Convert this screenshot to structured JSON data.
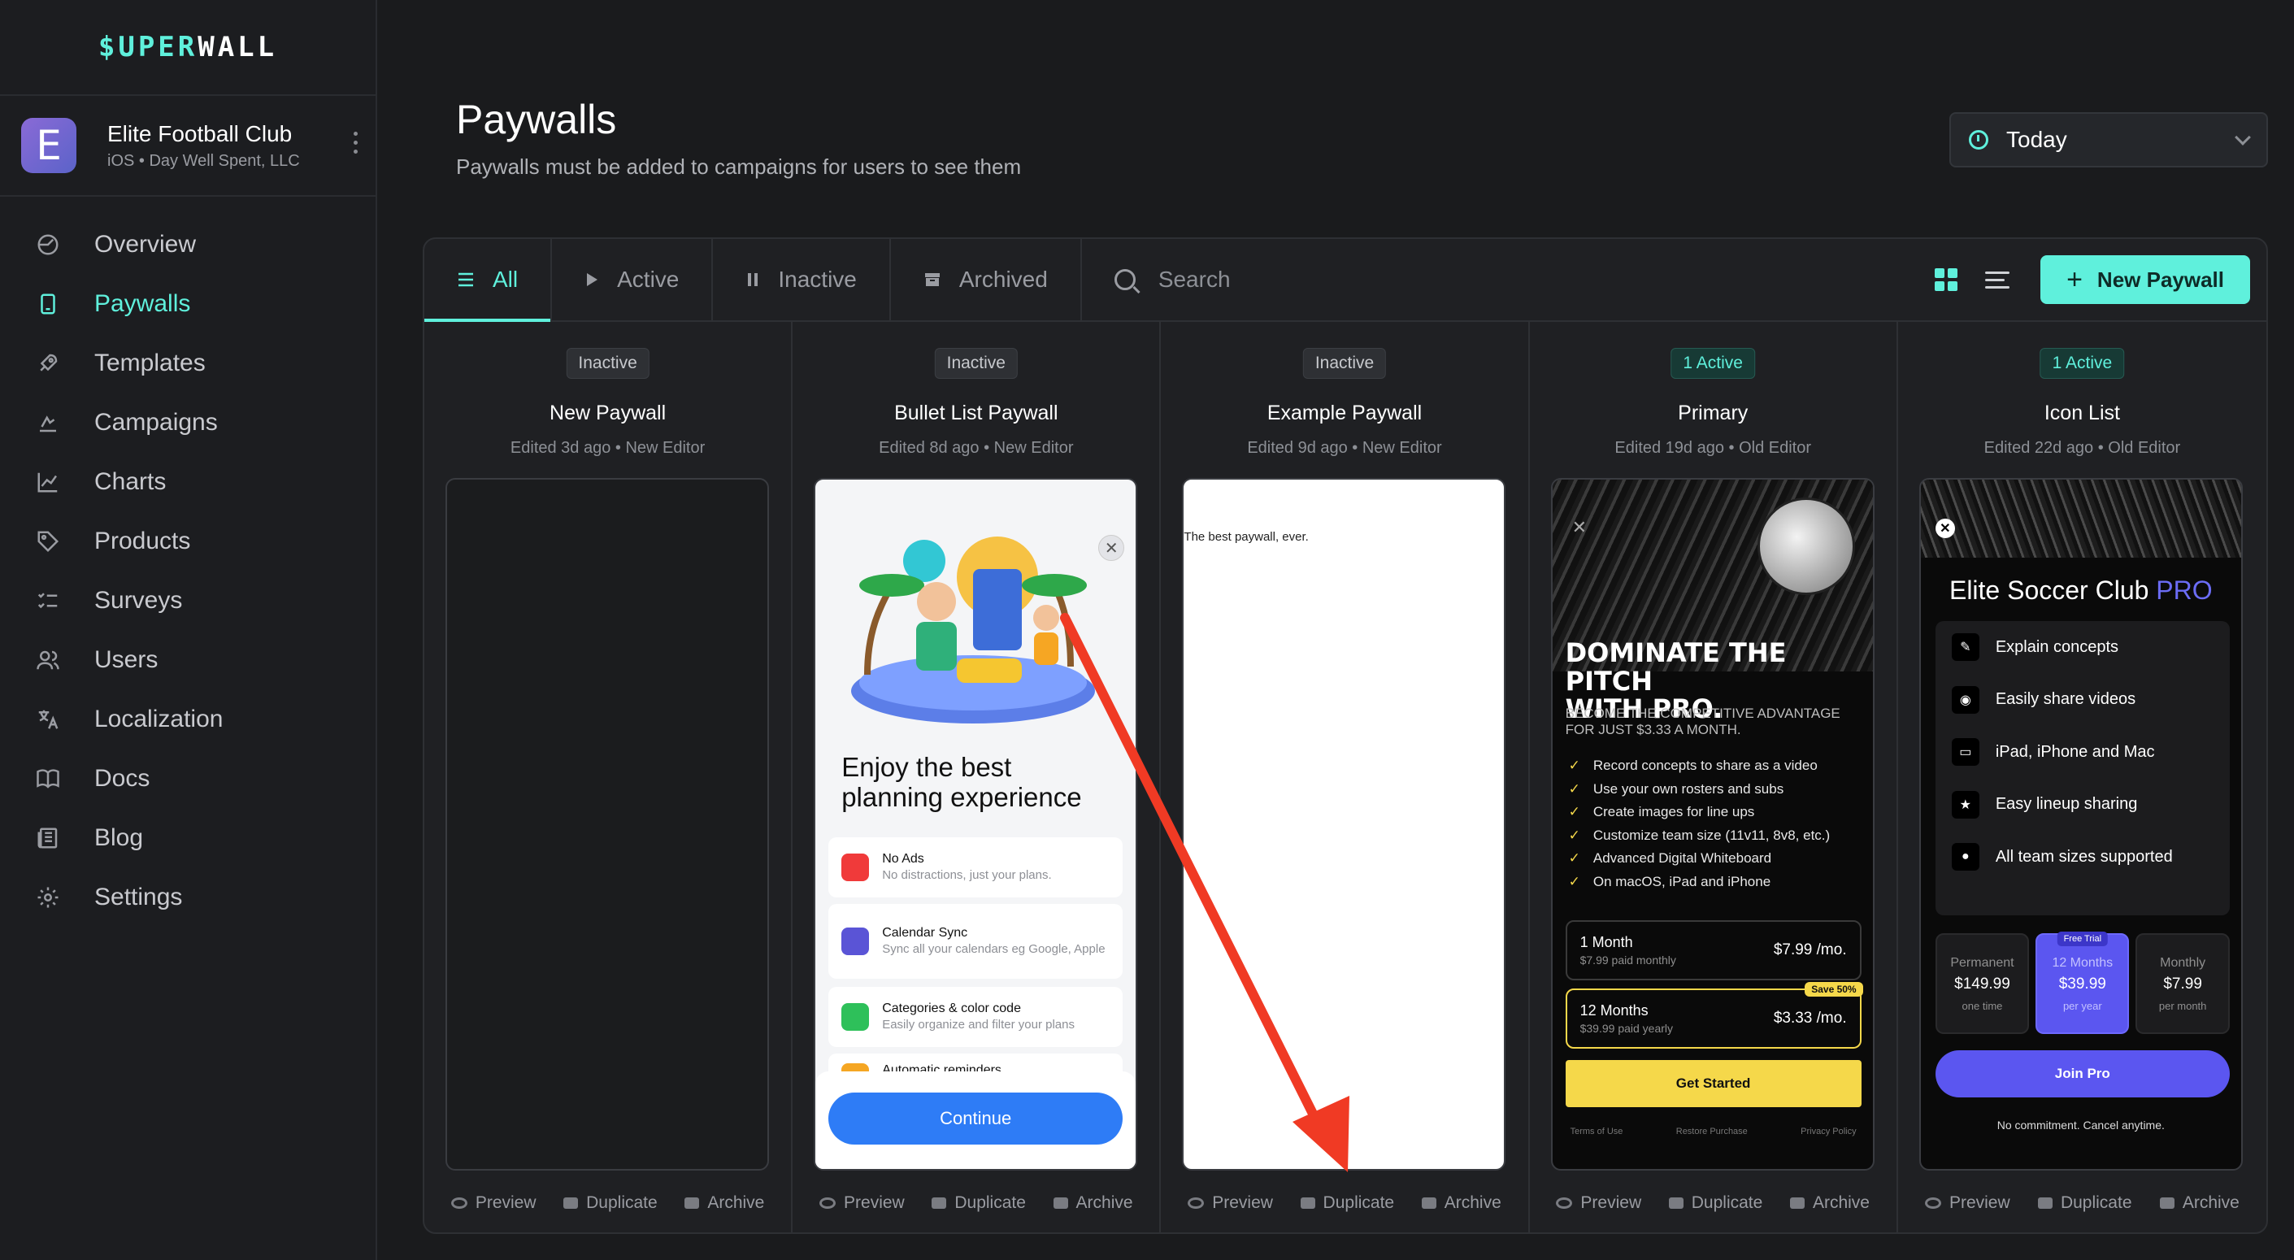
{
  "brand": {
    "logo_part1": "$UPER",
    "logo_part2": "WALL"
  },
  "org": {
    "avatar_letter": "E",
    "name": "Elite Football Club",
    "subtitle": "iOS • Day Well Spent, LLC"
  },
  "nav": [
    {
      "label": "Overview",
      "icon": "clock-icon"
    },
    {
      "label": "Paywalls",
      "icon": "phone-icon",
      "active": true
    },
    {
      "label": "Templates",
      "icon": "rocket-icon"
    },
    {
      "label": "Campaigns",
      "icon": "campaign-icon"
    },
    {
      "label": "Charts",
      "icon": "chart-icon"
    },
    {
      "label": "Products",
      "icon": "tag-icon"
    },
    {
      "label": "Surveys",
      "icon": "checklist-icon"
    },
    {
      "label": "Users",
      "icon": "users-icon"
    },
    {
      "label": "Localization",
      "icon": "translate-icon"
    },
    {
      "label": "Docs",
      "icon": "book-icon"
    },
    {
      "label": "Blog",
      "icon": "newspaper-icon"
    },
    {
      "label": "Settings",
      "icon": "gear-icon"
    }
  ],
  "header": {
    "title": "Paywalls",
    "subtitle": "Paywalls must be added to campaigns for users to see them"
  },
  "date_filter": {
    "value": "Today"
  },
  "tabs": [
    {
      "label": "All",
      "active": true
    },
    {
      "label": "Active"
    },
    {
      "label": "Inactive"
    },
    {
      "label": "Archived"
    }
  ],
  "search": {
    "placeholder": "Search"
  },
  "new_button": "New Paywall",
  "actions": {
    "preview": "Preview",
    "duplicate": "Duplicate",
    "archive": "Archive"
  },
  "cards": [
    {
      "status": "Inactive",
      "name": "New Paywall",
      "meta": "Edited 3d ago • New Editor"
    },
    {
      "status": "Inactive",
      "name": "Bullet List Paywall",
      "meta": "Edited 8d ago • New Editor"
    },
    {
      "status": "Inactive",
      "name": "Example Paywall",
      "meta": "Edited 9d ago • New Editor"
    },
    {
      "status": "1 Active",
      "name": "Primary",
      "meta": "Edited 19d ago • Old Editor"
    },
    {
      "status": "1 Active",
      "name": "Icon List",
      "meta": "Edited 22d ago • Old Editor"
    }
  ],
  "pv2": {
    "title": "Enjoy the best planning experience",
    "features": [
      {
        "title": "No Ads",
        "sub": "No distractions, just your plans.",
        "color": "#f03a3a"
      },
      {
        "title": "Calendar Sync",
        "sub": "Sync all your calendars eg Google, Apple",
        "color": "#5a54d6"
      },
      {
        "title": "Categories & color code",
        "sub": "Easily organize and filter your plans",
        "color": "#2ec05a"
      },
      {
        "title": "Automatic reminders",
        "sub": "",
        "color": "#f5a623"
      }
    ],
    "cta": "Continue"
  },
  "pv3": {
    "text": "The best paywall, ever."
  },
  "pv4": {
    "title_line1": "DOMINATE THE PITCH",
    "title_line2": "WITH PRO.",
    "subtitle": "Become the competitive advantage for just $3.33 a month.",
    "bullets": [
      "Record concepts to share as a video",
      "Use your own rosters and subs",
      "Create images for line ups",
      "Customize team size (11v11, 8v8, etc.)",
      "Advanced Digital Whiteboard",
      "On macOS, iPad and iPhone"
    ],
    "plan1": {
      "name": "1 Month",
      "sub": "$7.99 paid monthly",
      "price": "$7.99 /mo."
    },
    "plan2": {
      "name": "12 Months",
      "sub": "$39.99 paid yearly",
      "price": "$3.33 /mo.",
      "badge": "Save 50%"
    },
    "cta": "Get Started",
    "footer": [
      "Terms of Use",
      "Restore Purchase",
      "Privacy Policy"
    ]
  },
  "pv5": {
    "title": "Elite Soccer Club ",
    "title_accent": "PRO",
    "features": [
      "Explain concepts",
      "Easily share videos",
      "iPad, iPhone and Mac",
      "Easy lineup sharing",
      "All team sizes supported"
    ],
    "tiers": [
      {
        "name": "Permanent",
        "price": "$149.99",
        "desc": "one time"
      },
      {
        "name": "12 Months",
        "price": "$39.99",
        "desc": "per year",
        "badge": "Free Trial"
      },
      {
        "name": "Monthly",
        "price": "$7.99",
        "desc": "per month"
      }
    ],
    "cta": "Join Pro",
    "note": "No commitment. Cancel anytime."
  },
  "colors": {
    "accent": "#5ff0dc",
    "annotation_arrow": "#f03a24"
  }
}
